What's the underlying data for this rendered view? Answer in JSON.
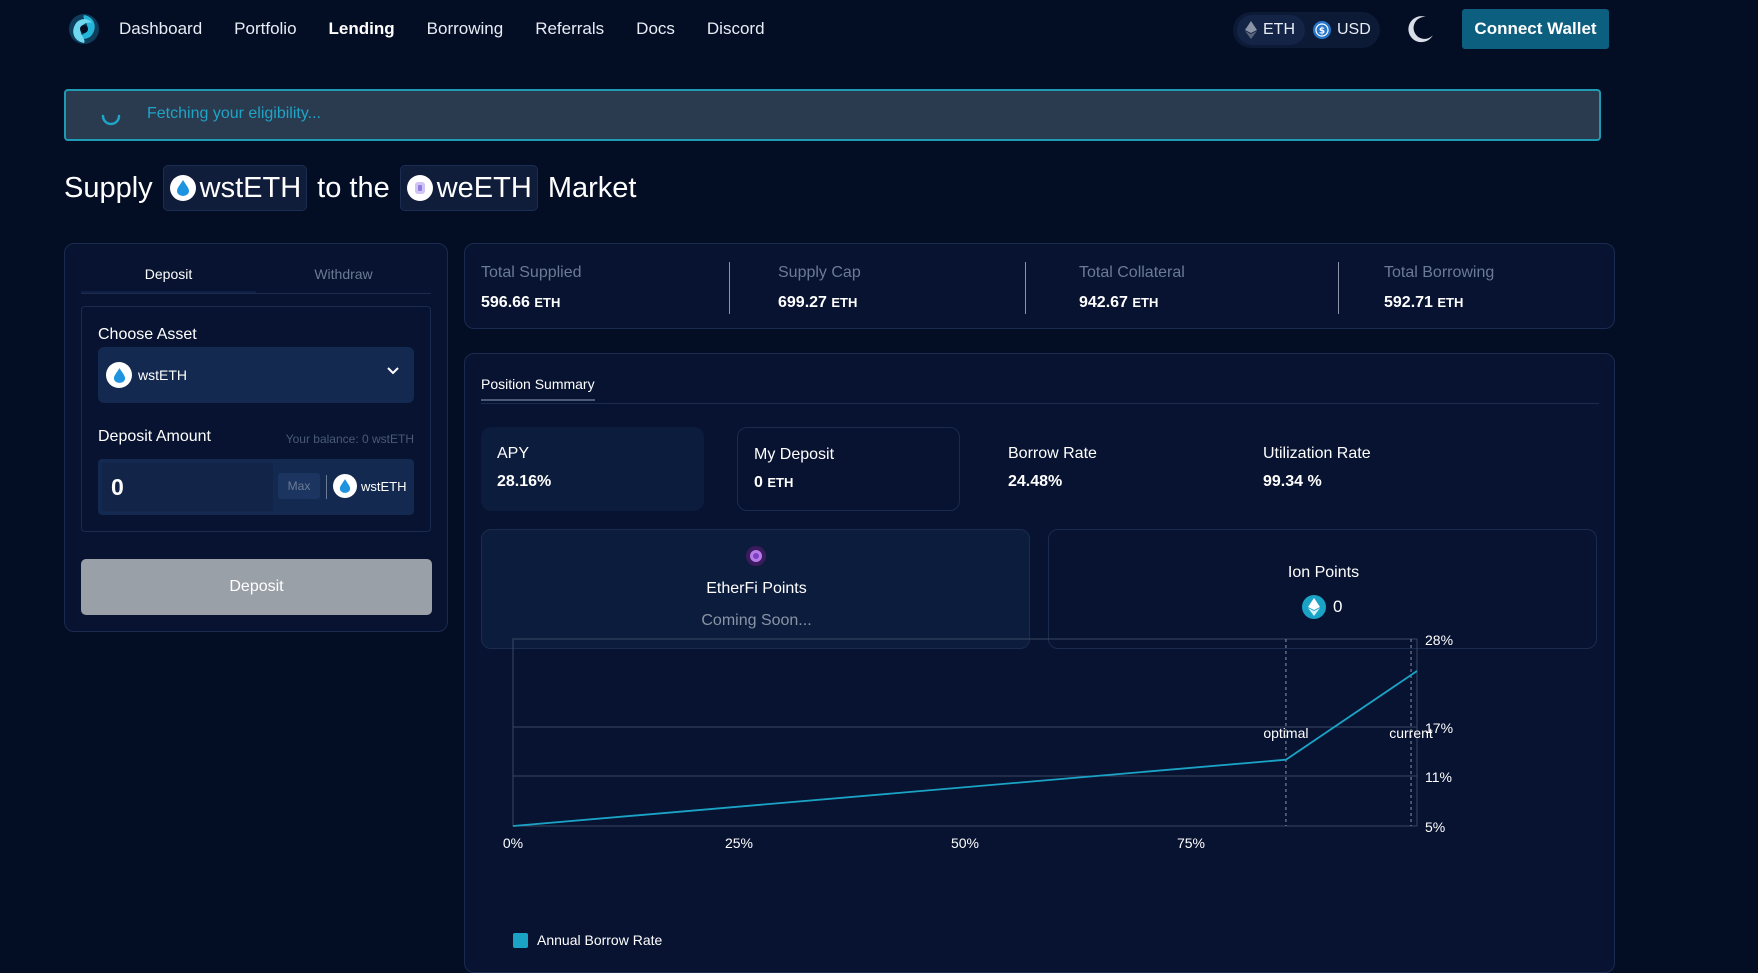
{
  "nav": {
    "links": [
      "Dashboard",
      "Portfolio",
      "Lending",
      "Borrowing",
      "Referrals",
      "Docs",
      "Discord"
    ],
    "active": "Lending",
    "unit_eth": "ETH",
    "unit_usd": "USD",
    "connect_label": "Connect Wallet"
  },
  "banner": {
    "text": "Fetching your eligibility..."
  },
  "title": {
    "supply": "Supply",
    "asset": "wstETH",
    "to_the": "to the",
    "market_asset": "weETH",
    "market": "Market"
  },
  "left_panel": {
    "tab_deposit": "Deposit",
    "tab_withdraw": "Withdraw",
    "choose_asset_label": "Choose Asset",
    "selected_asset": "wstETH",
    "deposit_amount_label": "Deposit Amount",
    "balance": "Your balance: 0 wstETH",
    "amount_value": "0",
    "max_label": "Max",
    "amount_token": "wstETH",
    "deposit_button": "Deposit"
  },
  "stats": [
    {
      "label": "Total Supplied",
      "value": "596.66",
      "unit": "ETH"
    },
    {
      "label": "Supply Cap",
      "value": "699.27",
      "unit": "ETH"
    },
    {
      "label": "Total Collateral",
      "value": "942.67",
      "unit": "ETH"
    },
    {
      "label": "Total Borrowing",
      "value": "592.71",
      "unit": "ETH"
    }
  ],
  "position": {
    "tab": "Position Summary",
    "apy_label": "APY",
    "apy_value": "28.16%",
    "deposit_label": "My Deposit",
    "deposit_value": "0",
    "deposit_unit": "ETH",
    "borrow_rate_label": "Borrow Rate",
    "borrow_rate_value": "24.48%",
    "util_label": "Utilization Rate",
    "util_value": "99.34 %",
    "etherfi_label": "EtherFi Points",
    "etherfi_value": "Coming Soon...",
    "ion_label": "Ion Points",
    "ion_value": "0"
  },
  "colors": {
    "accent": "#1ba3c6",
    "button": "#0c5f7f",
    "background": "#030d24"
  },
  "chart_data": {
    "type": "line",
    "x_tick_labels": [
      "0%",
      "25%",
      "50%",
      "75%"
    ],
    "y_tick_labels": [
      "28%",
      "17%",
      "11%",
      "5%"
    ],
    "xlim": [
      0,
      100
    ],
    "y_ticks": [
      5,
      11,
      17,
      28
    ],
    "series": [
      {
        "name": "Annual Borrow Rate",
        "x": [
          0,
          85.5,
          100
        ],
        "y": [
          5,
          13,
          24
        ]
      }
    ],
    "annotations": [
      {
        "label": "optimal",
        "x": 85.5
      },
      {
        "label": "current",
        "x": 99.34
      }
    ],
    "grid": true,
    "legend": "bottom-left"
  }
}
